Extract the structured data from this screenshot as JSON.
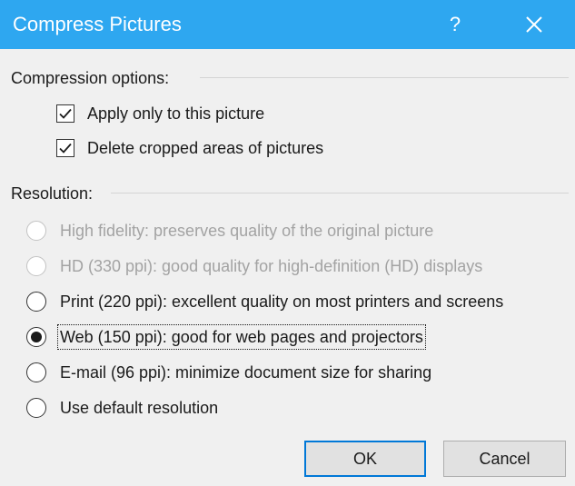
{
  "window": {
    "title": "Compress Pictures",
    "help_label": "?",
    "close_icon": "close-icon",
    "titlebar_color": "#2ea7f0"
  },
  "compression": {
    "label": "Compression options:",
    "options": [
      {
        "label": "Apply only to this picture",
        "checked": true
      },
      {
        "label": "Delete cropped areas of pictures",
        "checked": true
      }
    ]
  },
  "resolution": {
    "label": "Resolution:",
    "options": [
      {
        "label": "High fidelity: preserves quality of the original picture",
        "disabled": true,
        "selected": false
      },
      {
        "label": "HD (330 ppi): good quality for high-definition (HD) displays",
        "disabled": true,
        "selected": false
      },
      {
        "label": "Print (220 ppi): excellent quality on most printers and screens",
        "disabled": false,
        "selected": false
      },
      {
        "label": "Web (150 ppi): good for web pages and projectors",
        "disabled": false,
        "selected": true
      },
      {
        "label": "E-mail (96 ppi): minimize document size for sharing",
        "disabled": false,
        "selected": false
      },
      {
        "label": "Use default resolution",
        "disabled": false,
        "selected": false
      }
    ]
  },
  "buttons": {
    "ok_label": "OK",
    "cancel_label": "Cancel",
    "accent_color": "#0078d7"
  }
}
